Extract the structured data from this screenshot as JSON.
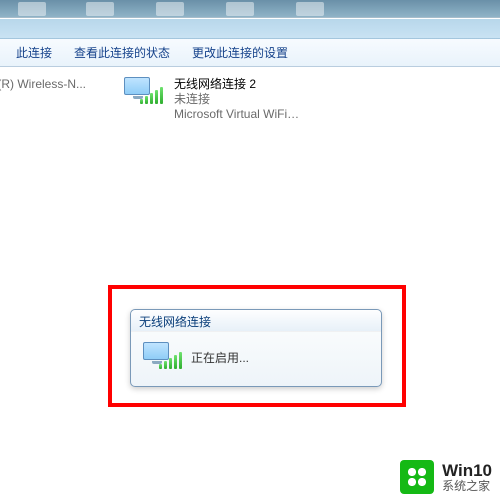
{
  "toolbar": {
    "items": [
      {
        "label": "此连接"
      },
      {
        "label": "查看此连接的状态"
      },
      {
        "label": "更改此连接的设置"
      }
    ]
  },
  "adapters": [
    {
      "name": "",
      "status": "",
      "device": "no(R) Wireless-N...",
      "disabled": true
    },
    {
      "name": "无线网络连接 2",
      "status": "未连接",
      "device": "Microsoft Virtual WiFi Minipor...",
      "disabled": false
    }
  ],
  "dialog": {
    "title": "无线网络连接",
    "message": "正在启用..."
  },
  "watermark": {
    "line1": "Win10",
    "line2": "系统之家"
  }
}
